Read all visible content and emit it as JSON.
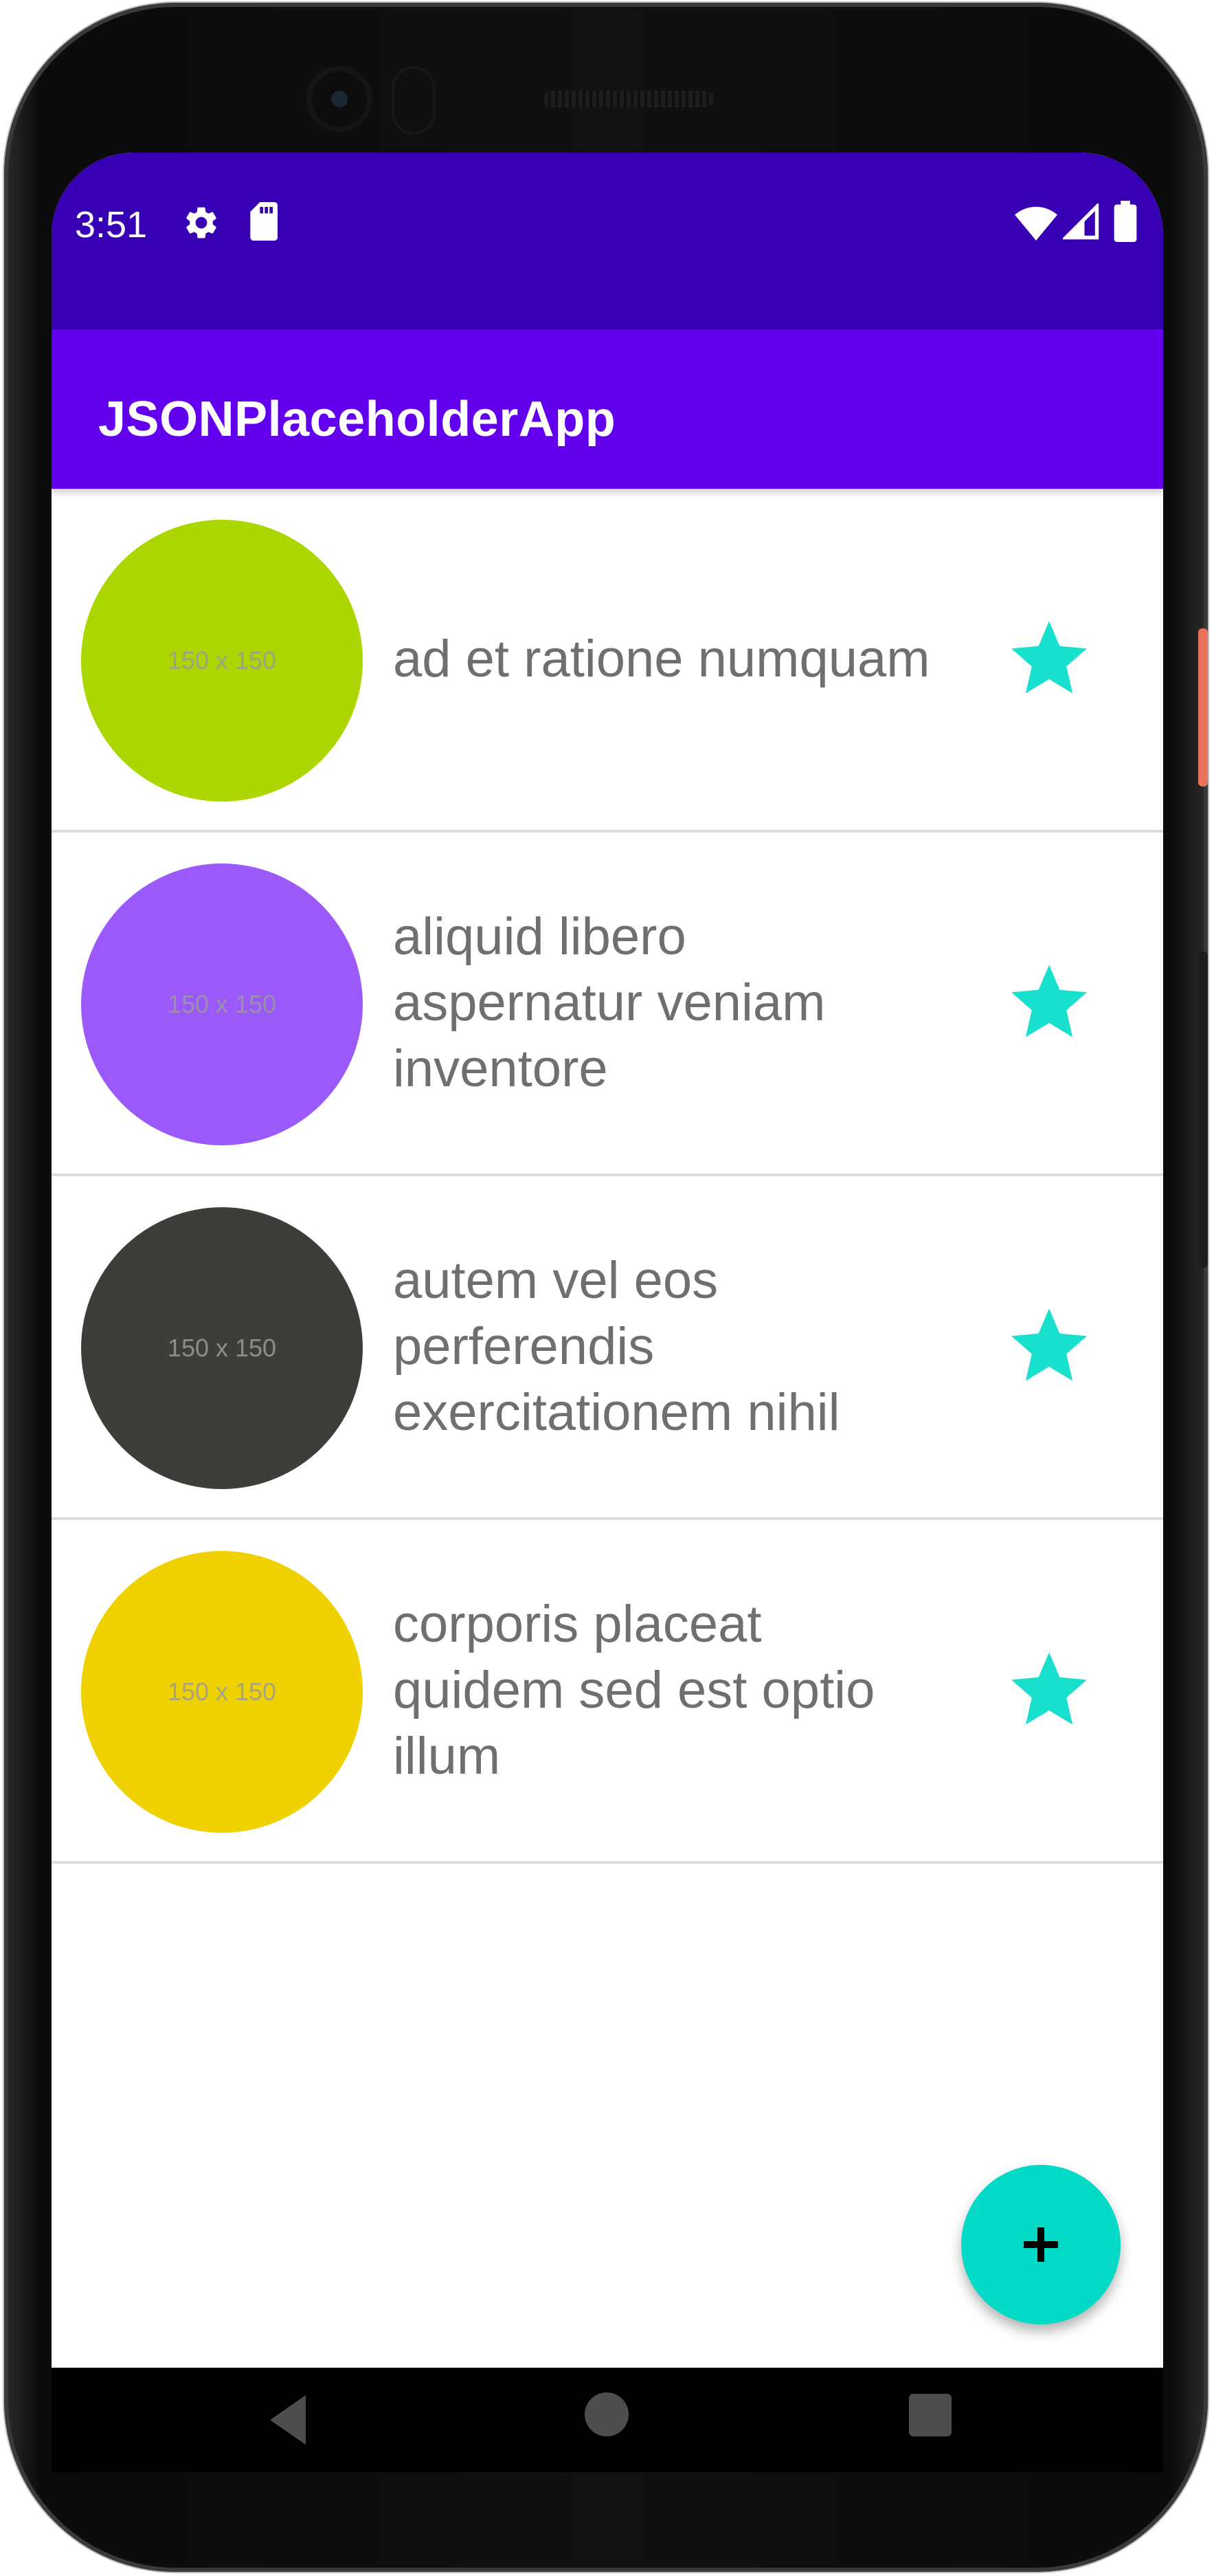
{
  "status_bar": {
    "time": "3:51",
    "icons": [
      "gear-icon",
      "sd-card-icon",
      "wifi-icon",
      "signal-icon",
      "battery-icon"
    ]
  },
  "app_bar": {
    "title": "JSONPlaceholderApp"
  },
  "colors": {
    "status_bar": "#3700b3",
    "app_bar": "#6200ee",
    "accent": "#03dac5",
    "star": "#19e0cc",
    "title_text": "#6f6f6f"
  },
  "items": [
    {
      "thumb_text": "150 x 150",
      "thumb_color": "#acd600",
      "title": "ad et ratione numquam",
      "icon": "star-icon"
    },
    {
      "thumb_text": "150 x 150",
      "thumb_color": "#9b59fa",
      "title": "aliquid libero aspernatur veniam inventore",
      "icon": "star-icon"
    },
    {
      "thumb_text": "150 x 150",
      "thumb_color": "#3d3d39",
      "title": "autem vel eos perferendis exercitationem nihil",
      "icon": "star-icon"
    },
    {
      "thumb_text": "150 x 150",
      "thumb_color": "#f0d100",
      "title": "corporis placeat quidem sed est optio illum",
      "icon": "star-icon"
    }
  ],
  "fab": {
    "icon": "plus-icon"
  },
  "nav_bar": {
    "icons": [
      "back-icon",
      "home-icon",
      "recents-icon"
    ]
  }
}
